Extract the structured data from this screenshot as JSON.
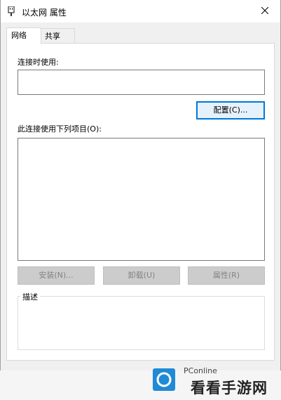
{
  "window": {
    "title": "以太网 属性"
  },
  "tabs": [
    {
      "label": "网络",
      "active": true
    },
    {
      "label": "共享",
      "active": false
    }
  ],
  "connection": {
    "connect_using_label": "连接时使用:",
    "adapter_value": "",
    "configure_label": "配置(C)..."
  },
  "items": {
    "label": "此连接使用下列项目(O):",
    "list": []
  },
  "actions": {
    "install_label": "安装(N)...",
    "uninstall_label": "卸载(U)",
    "properties_label": "属性(R)"
  },
  "description": {
    "label": "描述",
    "text": ""
  },
  "watermark": {
    "brand": "PConline",
    "site": "看看手游网"
  },
  "colors": {
    "accent": "#0078d7",
    "logo": "#1f8ad6"
  }
}
